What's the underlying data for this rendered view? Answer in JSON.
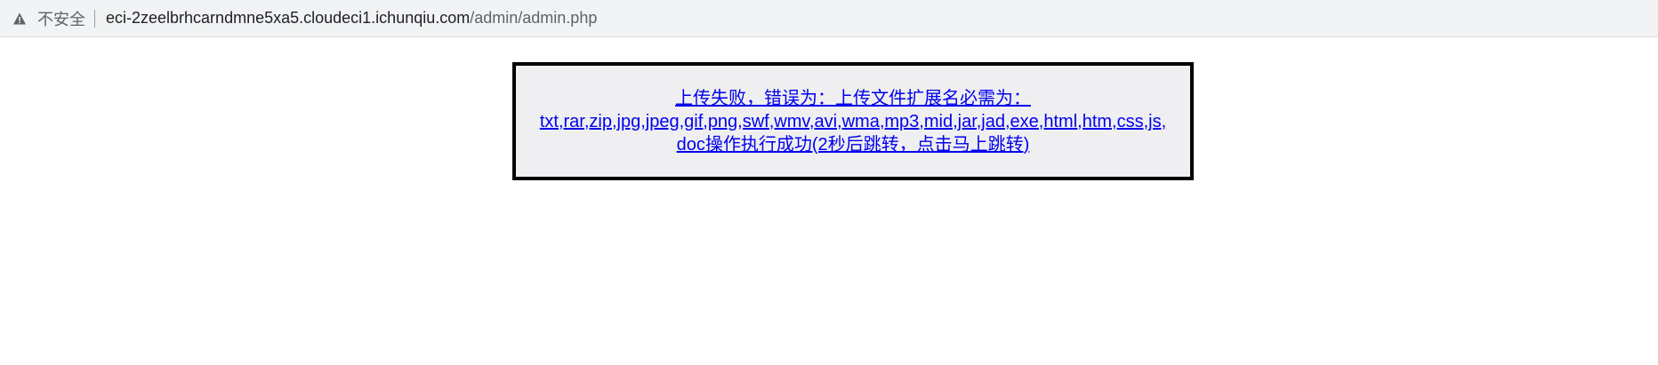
{
  "browser": {
    "security_label": "不安全",
    "warning_icon": "warning-triangle-icon",
    "url_host": "eci-2zeelbrhcarndmne5xa5.cloudeci1.ichunqiu.com",
    "url_path": "/admin/admin.php"
  },
  "message": {
    "line1": "上传失败，错误为：上传文件扩展名必需为：",
    "line2": "txt,rar,zip,jpg,jpeg,gif,png,swf,wmv,avi,wma,mp3,mid,jar,jad,exe,html,htm,css,js,",
    "line3": "doc操作执行成功(2秒后跳转，点击马上跳转)"
  }
}
